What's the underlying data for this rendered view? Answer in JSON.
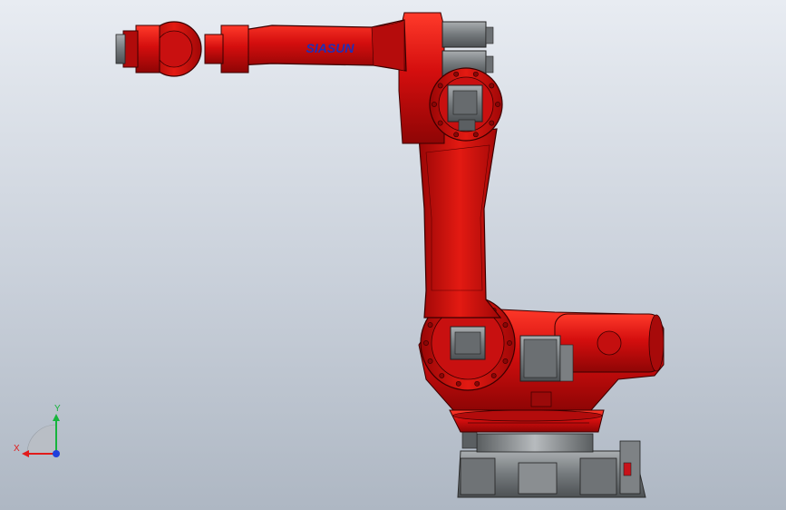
{
  "viewport": {
    "background": [
      "#e8ecf2",
      "#aeb7c3"
    ],
    "model": {
      "brand_label": "SIASUN",
      "body_color": "#d40e0e",
      "metal_color": "#7b7f82"
    },
    "triad": {
      "x_label": "X",
      "y_label": "Y",
      "x_color": "#e11b1b",
      "y_color": "#16b43c",
      "z_color": "#1f3fdc"
    }
  }
}
